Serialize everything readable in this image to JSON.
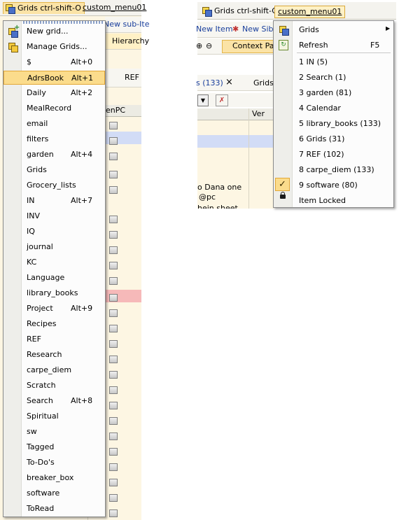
{
  "left": {
    "menubar": {
      "grids_tab": "Grids  ctrl-shift-O",
      "custom_tab": "custom_menu01"
    },
    "bg": {
      "new_sub_item": "New sub-Ite",
      "hierarchy": "Hierarchy",
      "ref": "REF",
      "col_pc": "enPC"
    },
    "menu_items": [
      {
        "label": "New grid...",
        "shortcut": ""
      },
      {
        "label": "Manage Grids...",
        "shortcut": ""
      },
      {
        "label": "$",
        "shortcut": "Alt+0"
      },
      {
        "label": "AdrsBook",
        "shortcut": "Alt+1"
      },
      {
        "label": "Daily",
        "shortcut": "Alt+2"
      },
      {
        "label": "MealRecord",
        "shortcut": ""
      },
      {
        "label": "email",
        "shortcut": ""
      },
      {
        "label": "filters",
        "shortcut": ""
      },
      {
        "label": "garden",
        "shortcut": "Alt+4"
      },
      {
        "label": "Grids",
        "shortcut": ""
      },
      {
        "label": "Grocery_lists",
        "shortcut": ""
      },
      {
        "label": "IN",
        "shortcut": "Alt+7"
      },
      {
        "label": "INV",
        "shortcut": ""
      },
      {
        "label": "IQ",
        "shortcut": ""
      },
      {
        "label": "journal",
        "shortcut": ""
      },
      {
        "label": "KC",
        "shortcut": ""
      },
      {
        "label": "Language",
        "shortcut": ""
      },
      {
        "label": "library_books",
        "shortcut": ""
      },
      {
        "label": "Project",
        "shortcut": "Alt+9"
      },
      {
        "label": "Recipes",
        "shortcut": ""
      },
      {
        "label": "REF",
        "shortcut": ""
      },
      {
        "label": "Research",
        "shortcut": ""
      },
      {
        "label": "carpe_diem",
        "shortcut": ""
      },
      {
        "label": "Scratch",
        "shortcut": ""
      },
      {
        "label": "Search",
        "shortcut": "Alt+8"
      },
      {
        "label": "Spiritual",
        "shortcut": ""
      },
      {
        "label": "sw",
        "shortcut": ""
      },
      {
        "label": "Tagged",
        "shortcut": ""
      },
      {
        "label": "To-Do's",
        "shortcut": ""
      },
      {
        "label": "breaker_box",
        "shortcut": ""
      },
      {
        "label": "software",
        "shortcut": ""
      },
      {
        "label": "ToRead",
        "shortcut": ""
      }
    ],
    "highlighted_index": 3
  },
  "right": {
    "menubar": {
      "grids_tab": "Grids  ctrl-shift-O",
      "custom_tab": "custom_menu01"
    },
    "bg": {
      "new_item": "New Item",
      "new_sibling": "New Sibli",
      "context_pane": "Context Pa",
      "tab_count": "s (133)",
      "close_x": "×",
      "grids": "Grids",
      "col_ver": "Ver",
      "cell_line1": "o Dana one",
      "cell_line2": "@pc",
      "cell_line3": "hein sheet"
    },
    "menu_items": [
      {
        "label": "Grids",
        "shortcut": "",
        "submenu": true
      },
      {
        "label": "Refresh",
        "shortcut": "F5"
      },
      {
        "label": "1 IN (5)"
      },
      {
        "label": "2 Search (1)"
      },
      {
        "label": "3 garden (81)"
      },
      {
        "label": "4 Calendar"
      },
      {
        "label": "5 library_books (133)"
      },
      {
        "label": "6 Grids (31)"
      },
      {
        "label": "7 REF (102)"
      },
      {
        "label": "8 carpe_diem (133)"
      },
      {
        "label": "9 software (80)",
        "checked": true
      },
      {
        "label": "Item Locked"
      }
    ]
  },
  "colors": {
    "highlight": "#fbdc8c",
    "highlight_border": "#e2a736",
    "pink_row": "#f6b9b9",
    "blue_row": "#d2dcf6"
  }
}
